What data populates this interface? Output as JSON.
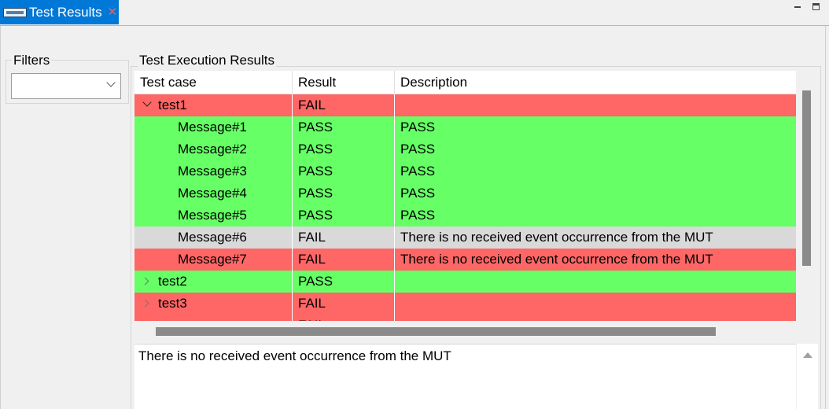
{
  "view": {
    "tab_title": "Test Results",
    "tab_icon": "test-results-view-icon",
    "close_icon": "close-icon"
  },
  "filters": {
    "label": "Filters",
    "selected_value": ""
  },
  "results": {
    "label": "Test Execution Results",
    "columns": [
      "Test case",
      "Result",
      "Description"
    ],
    "rows": [
      {
        "name": "test1",
        "result": "FAIL",
        "description": "",
        "level": 0,
        "expander": "expanded",
        "status": "fail"
      },
      {
        "name": "Message#1",
        "result": "PASS",
        "description": "PASS",
        "level": 1,
        "expander": "",
        "status": "pass"
      },
      {
        "name": "Message#2",
        "result": "PASS",
        "description": "PASS",
        "level": 1,
        "expander": "",
        "status": "pass"
      },
      {
        "name": "Message#3",
        "result": "PASS",
        "description": "PASS",
        "level": 1,
        "expander": "",
        "status": "pass"
      },
      {
        "name": "Message#4",
        "result": "PASS",
        "description": "PASS",
        "level": 1,
        "expander": "",
        "status": "pass"
      },
      {
        "name": "Message#5",
        "result": "PASS",
        "description": "PASS",
        "level": 1,
        "expander": "",
        "status": "pass"
      },
      {
        "name": "Message#6",
        "result": "FAIL",
        "description": "There is no received event occurrence from the MUT",
        "level": 1,
        "expander": "",
        "status": "selected"
      },
      {
        "name": "Message#7",
        "result": "FAIL",
        "description": "There is no received event occurrence from the MUT",
        "level": 1,
        "expander": "",
        "status": "fail"
      },
      {
        "name": "test2",
        "result": "PASS",
        "description": "",
        "level": 0,
        "expander": "collapsed",
        "status": "pass"
      },
      {
        "name": "test3",
        "result": "FAIL",
        "description": "",
        "level": 0,
        "expander": "collapsed",
        "status": "fail"
      },
      {
        "name": "",
        "result": "FAIL",
        "description": "",
        "level": 0,
        "expander": "",
        "status": "fail"
      }
    ]
  },
  "detail": {
    "text": "There is no received event occurrence from the MUT"
  },
  "colors": {
    "fail": "#ff6666",
    "pass": "#66ff66",
    "selected": "#d9d9d9",
    "tab_active": "#0078d7"
  }
}
